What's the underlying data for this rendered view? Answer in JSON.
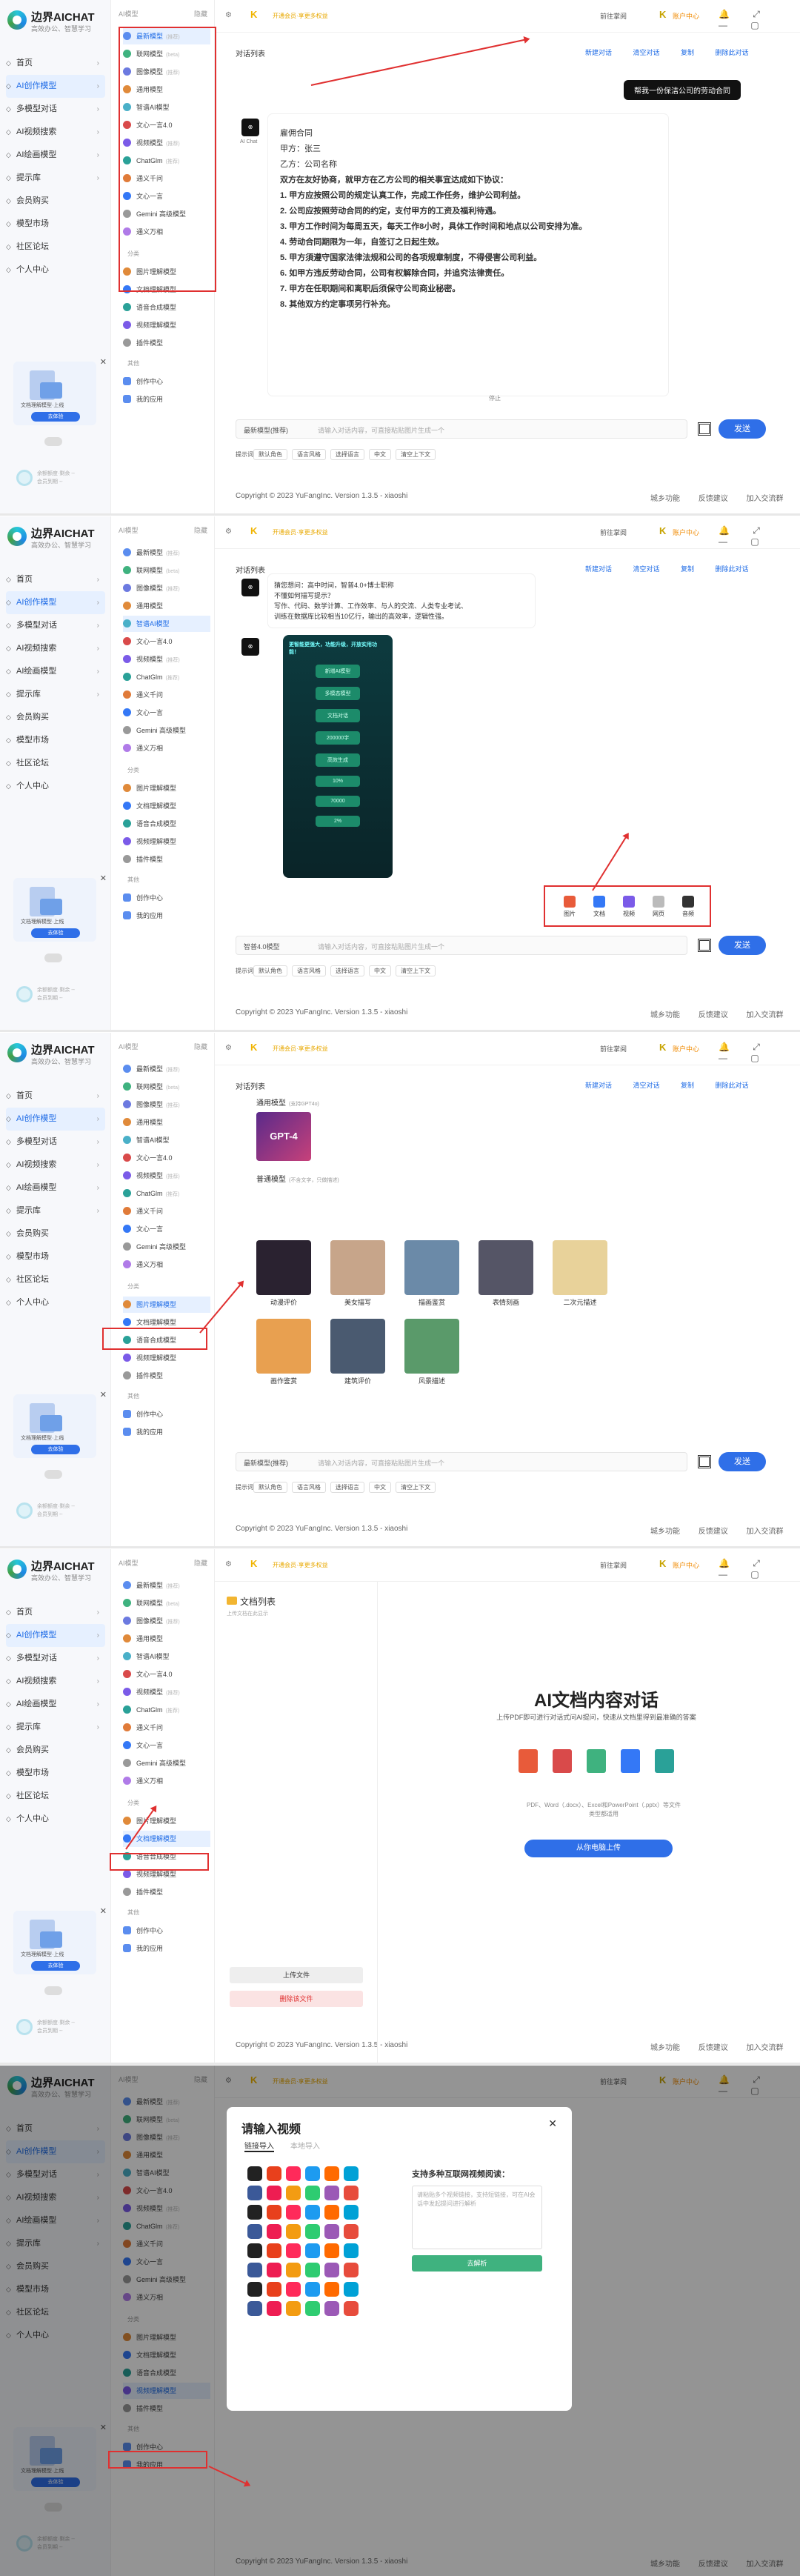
{
  "brand": {
    "name": "边界AICHAT",
    "slogan": "高效办公、智慧学习"
  },
  "menu": [
    "首页",
    "AI创作模型",
    "多模型对话",
    "AI视频搜索",
    "AI绘画模型",
    "提示库",
    "会员购买",
    "模型市场",
    "社区论坛",
    "个人中心"
  ],
  "submenu_header": {
    "left": "AI模型",
    "right": "隐藏"
  },
  "submenu": [
    {
      "label": "最新模型",
      "badge": "(推荐)"
    },
    {
      "label": "联网模型",
      "badge": "(beta)"
    },
    {
      "label": "图像模型",
      "badge": "(推荐)"
    },
    {
      "label": "通用模型",
      "badge": ""
    },
    {
      "label": "智谱AI模型",
      "badge": ""
    },
    {
      "label": "文心一言4.0",
      "badge": ""
    },
    {
      "label": "视频模型",
      "badge": "(推荐)"
    },
    {
      "label": "ChatGlm",
      "badge": "(推荐)"
    },
    {
      "label": "通义千问",
      "badge": ""
    },
    {
      "label": "文心一言",
      "badge": ""
    },
    {
      "label": "Gemini 高级模型",
      "badge": ""
    },
    {
      "label": "通义万相",
      "badge": ""
    }
  ],
  "submenu_sep": "分类",
  "submenu2": [
    "图片理解模型",
    "文档理解模型",
    "语音合成模型",
    "视频理解模型",
    "插件模型"
  ],
  "submenu3_sep": "其他",
  "submenu3": [
    "创作中心",
    "我的应用"
  ],
  "promo": {
    "text": "文档理解模型·上线",
    "button": "去体验"
  },
  "account": {
    "line1": "余额额度·剩余 --",
    "line2": "会员到期 --"
  },
  "topbar": {
    "tag": "会话",
    "vip": "开通会员·享更多权益",
    "r1": "前往掌阅",
    "r3": "账户中心",
    "controls": "🔔 ⤢ — ▢ ✕"
  },
  "s1": {
    "title": "对话列表",
    "tabs": "新建对话 清空对话 复制 删除此对话",
    "user_msg": "帮我一份保洁公司的劳动合同",
    "ai_label": "AI Chat",
    "content": [
      "雇佣合同",
      "甲方：张三",
      "乙方：公司名称",
      "双方在友好协商，就甲方在乙方公司的相关事宜达成如下协议：",
      "1. 甲方应按照公司的规定认真工作，完成工作任务，维护公司利益。",
      "2. 公司应按照劳动合同的约定，支付甲方的工资及福利待遇。",
      "3. 甲方工作时间为每周五天，每天工作8小时，具体工作时间和地点以公司安排为准。",
      "4. 劳动合同期限为一年，自签订之日起生效。",
      "5. 甲方須遵守国家法律法规和公司的各项规章制度，不得侵害公司利益。",
      "6. 如甲方违反劳动合同，公司有权解除合同，并追究法律责任。",
      "7. 甲方在任职期间和离职后须保守公司商业秘密。",
      "8. 其他双方约定事项另行补充。"
    ],
    "stop": "停止",
    "model": "最新模型(推荐)",
    "placeholder": "请输入对话内容，可直接粘贴图片生成一个",
    "send": "发送",
    "chips": [
      "提示词",
      "默认角色",
      "语言风格",
      "选择语言",
      "中文",
      "清空上下文"
    ]
  },
  "s2": {
    "intro": [
      "猜您想问：高中时间，智普4.0+博士职称",
      "不懂如何描写提示？",
      "写作、代码、数学计算、工作效率、与人的交流、人类专业考试、",
      "训练在数据库比较相当10亿行，输出的高效率，逻辑性强。"
    ],
    "poster_title": "更智能更强大，功能升级，开放实用功能！",
    "poster_rows": [
      "新增AI模型",
      "多模态模型",
      "文档对话",
      "200000字",
      "高效生成",
      "10%",
      "70000",
      "2%"
    ],
    "tools": [
      "图片",
      "文档",
      "视频",
      "网页",
      "音频"
    ],
    "model": "智普4.0模型"
  },
  "s3": {
    "h1": "通用模型",
    "h1b": "(支持GPT4o)",
    "gpt": "GPT-4",
    "h2": "普通模型",
    "h2b": "(不含文字，只做描述)",
    "row1": [
      "动漫评价",
      "美女描写",
      "描画鉴赏",
      "表情刻画",
      "二次元描述"
    ],
    "row2": [
      "画作鉴赏",
      "建筑评价",
      "风景描述"
    ]
  },
  "s4": {
    "title": "文档列表",
    "desc": "上传文档在此显示",
    "h": "AI文档内容对话",
    "sub": "上传PDF即可进行对话式问AI提问，快速从文档里得到最准确的答案",
    "types": "PDF、Word（.docx）、Excel和PowerPoint（.pptx）等文件类型都适用",
    "upload": "从你电脑上传",
    "btn1": "上传文件",
    "btn2": "删除该文件"
  },
  "s5": {
    "title": "请输入视频",
    "tab1": "链接导入",
    "tab2": "本地导入",
    "sup": "支持多种互联网视频阅读：",
    "ph": "请粘贴多个视频链接，支持短链接，可在AI会话中发起提问进行解析",
    "btn": "去解析"
  },
  "footer": {
    "copy": "Copyright © 2023 YuFangInc. Version 1.3.5 - xiaoshi",
    "links": "城乡功能 反馈建议 加入交流群"
  },
  "colors": {
    "accent": "#2f6fe8",
    "highlight": "#e03030"
  }
}
